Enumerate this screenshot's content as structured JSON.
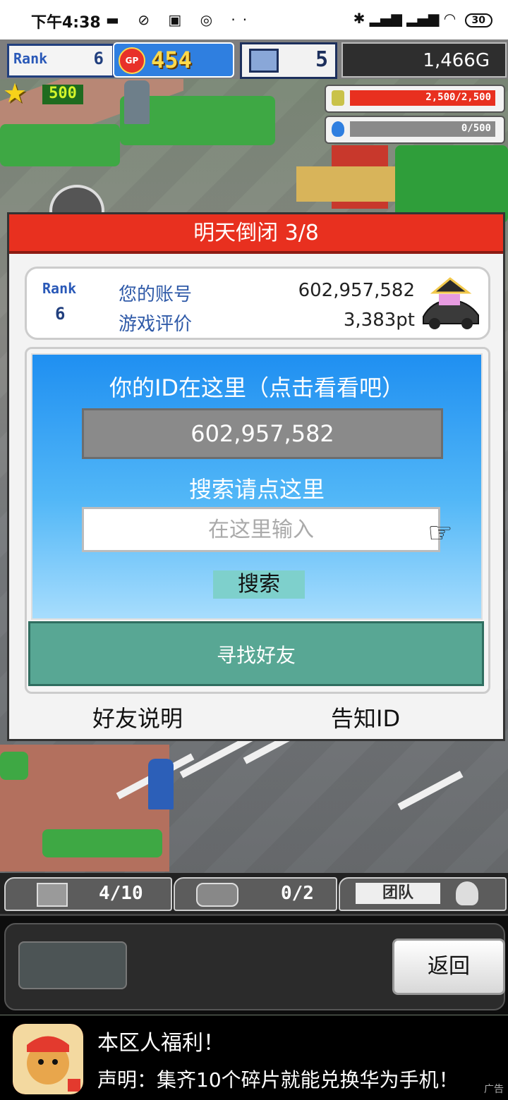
{
  "status_bar": {
    "time": "下午4:38",
    "battery": "30"
  },
  "hud": {
    "rank_label": "Rank",
    "rank_value": "6",
    "gp_icon": "GP",
    "gp_value": "454",
    "pc_value": "5",
    "money": "1,466G",
    "stars": "500",
    "coin_meter": {
      "text": "2,500/2,500",
      "fill_fraction": 1.0,
      "color": "#e8301f"
    },
    "drop_meter": {
      "text": "0/500",
      "fill_fraction": 0.0,
      "color": "#2f7fe0"
    }
  },
  "dialog": {
    "title": "明天倒闭 3/8",
    "account": {
      "rank_label": "Rank",
      "rank_value": "6",
      "account_label": "您的账号",
      "account_value": "602,957,582",
      "rating_label": "游戏评价",
      "rating_value": "3,383pt"
    },
    "id_heading": "你的ID在这里（点击看看吧）",
    "id_value": "602,957,582",
    "search_heading": "搜索请点这里",
    "search_placeholder": "在这里输入",
    "search_button": "搜索",
    "find_friend_button": "寻找好友",
    "friend_help_link": "好友说明",
    "share_id_link": "告知ID"
  },
  "dock": {
    "storage_value": "4/10",
    "garage_value": "0/2",
    "team_label": "团队"
  },
  "bottom_panel": {
    "back_button": "返回"
  },
  "ad": {
    "title": "本区人福利！",
    "description": "声明：集齐10个碎片就能兑换华为手机！",
    "tag": "广告"
  },
  "colors": {
    "title_red": "#e8301f",
    "panel_blue": "#1f8ff1",
    "find_friend_green": "#58a794",
    "label_blue": "#2f5aa8"
  },
  "icons": [
    "star-icon",
    "gp-coin-icon",
    "computer-icon",
    "coin-stack-icon",
    "water-drop-icon",
    "vip-badge-icon",
    "pointing-hand-icon",
    "box-icon",
    "garage-car-icon",
    "team-icon",
    "character-avatar-icon"
  ]
}
